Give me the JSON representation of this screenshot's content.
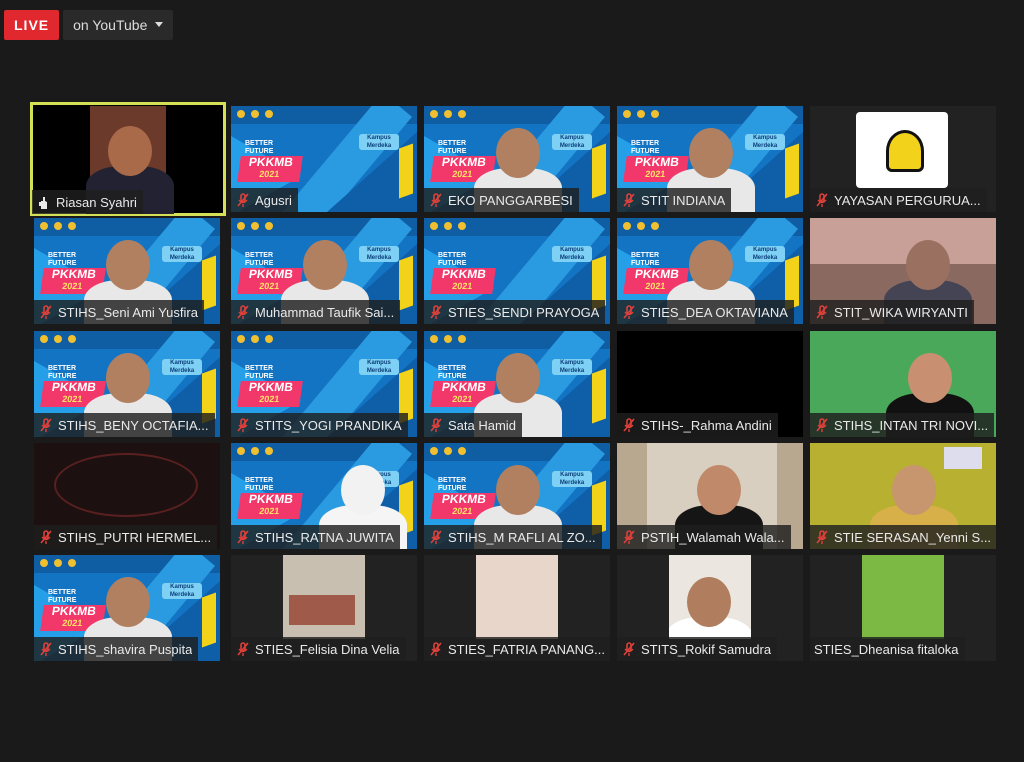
{
  "header": {
    "live_label": "LIVE",
    "stream_target_label": "on YouTube"
  },
  "colors": {
    "live_red": "#e0282e",
    "active_speaker_outline": "#d4e157",
    "mute_icon_red": "#e0403a",
    "background": "#1a1a1a"
  },
  "event_banner": {
    "line1": "BETTER",
    "line2": "FUTURE",
    "badge": "PKKMB",
    "year": "2021",
    "tag1": "Kampus",
    "tag2": "Merdeka"
  },
  "participants": [
    {
      "name": "Riasan Syahri",
      "mic": "raised-hand"
    },
    {
      "name": "Agusri",
      "mic": "muted"
    },
    {
      "name": "EKO PANGGARBESI",
      "mic": "muted"
    },
    {
      "name": "STIT INDIANA",
      "mic": "muted"
    },
    {
      "name": "YAYASAN PERGURUA...",
      "mic": "muted"
    },
    {
      "name": "STIHS_Seni Ami Yusfira",
      "mic": "muted"
    },
    {
      "name": "Muhammad Taufik Sai...",
      "mic": "muted"
    },
    {
      "name": "STIES_SENDI PRAYOGA",
      "mic": "muted"
    },
    {
      "name": "STIES_DEA OKTAVIANA",
      "mic": "muted"
    },
    {
      "name": "STIT_WIKA WIRYANTI",
      "mic": "muted"
    },
    {
      "name": "STIHS_BENY OCTAFIA...",
      "mic": "muted"
    },
    {
      "name": "STITS_YOGI PRANDIKA",
      "mic": "muted"
    },
    {
      "name": "Sata Hamid",
      "mic": "muted"
    },
    {
      "name": "STIHS-_Rahma Andini",
      "mic": "muted"
    },
    {
      "name": "STIHS_INTAN TRI NOVI...",
      "mic": "muted"
    },
    {
      "name": "STIHS_PUTRI HERMEL...",
      "mic": "muted"
    },
    {
      "name": "STIHS_RATNA JUWITA",
      "mic": "muted"
    },
    {
      "name": "STIHS_M RAFLI AL ZO...",
      "mic": "muted"
    },
    {
      "name": "PSTIH_Walamah Wala...",
      "mic": "muted"
    },
    {
      "name": "STIE SERASAN_Yenni S...",
      "mic": "muted"
    },
    {
      "name": "STIHS_shavira Puspita",
      "mic": "muted"
    },
    {
      "name": "STIES_Felisia Dina Velia",
      "mic": "muted"
    },
    {
      "name": "STIES_FATRIA PANANG...",
      "mic": "muted"
    },
    {
      "name": "STITS_Rokif Samudra",
      "mic": "muted"
    },
    {
      "name": "STIES_Dheanisa fitaloka",
      "mic": "none"
    }
  ]
}
